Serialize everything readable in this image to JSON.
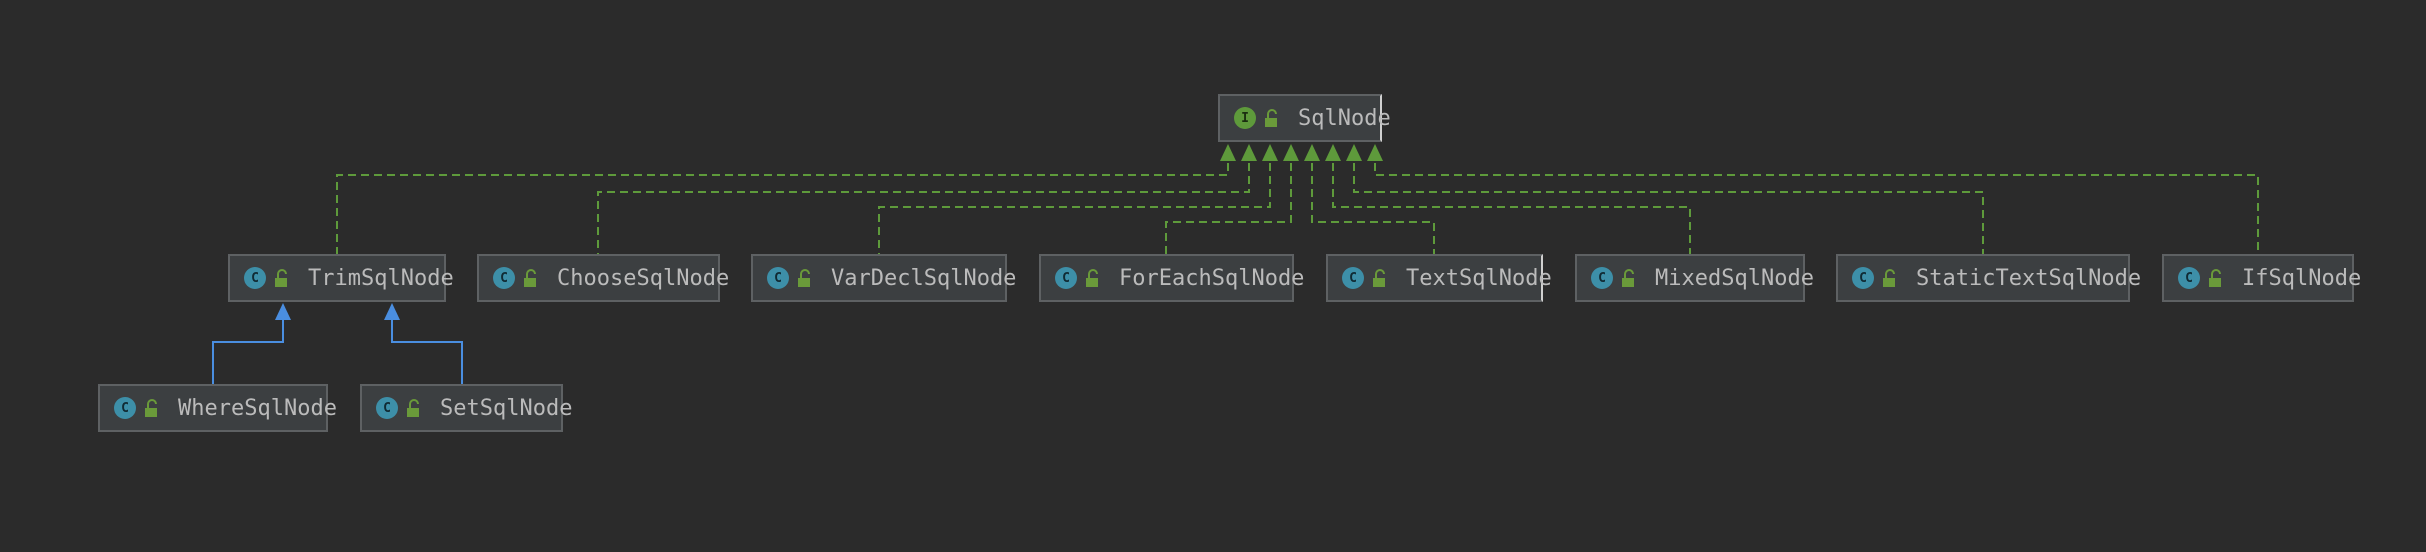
{
  "diagram": {
    "nodes": [
      {
        "id": "SqlNode",
        "name": "SqlNode",
        "kind": "interface",
        "kind_letter": "I"
      },
      {
        "id": "TrimSqlNode",
        "name": "TrimSqlNode",
        "kind": "class",
        "kind_letter": "C"
      },
      {
        "id": "ChooseSqlNode",
        "name": "ChooseSqlNode",
        "kind": "class",
        "kind_letter": "C"
      },
      {
        "id": "VarDeclSqlNode",
        "name": "VarDeclSqlNode",
        "kind": "class",
        "kind_letter": "C"
      },
      {
        "id": "ForEachSqlNode",
        "name": "ForEachSqlNode",
        "kind": "class",
        "kind_letter": "C"
      },
      {
        "id": "TextSqlNode",
        "name": "TextSqlNode",
        "kind": "class",
        "kind_letter": "C"
      },
      {
        "id": "MixedSqlNode",
        "name": "MixedSqlNode",
        "kind": "class",
        "kind_letter": "C"
      },
      {
        "id": "StaticTextSqlNode",
        "name": "StaticTextSqlNode",
        "kind": "class",
        "kind_letter": "C"
      },
      {
        "id": "IfSqlNode",
        "name": "IfSqlNode",
        "kind": "class",
        "kind_letter": "C"
      },
      {
        "id": "WhereSqlNode",
        "name": "WhereSqlNode",
        "kind": "class",
        "kind_letter": "C"
      },
      {
        "id": "SetSqlNode",
        "name": "SetSqlNode",
        "kind": "class",
        "kind_letter": "C"
      }
    ],
    "edges": [
      {
        "from": "TrimSqlNode",
        "to": "SqlNode",
        "relation": "implements"
      },
      {
        "from": "ChooseSqlNode",
        "to": "SqlNode",
        "relation": "implements"
      },
      {
        "from": "VarDeclSqlNode",
        "to": "SqlNode",
        "relation": "implements"
      },
      {
        "from": "ForEachSqlNode",
        "to": "SqlNode",
        "relation": "implements"
      },
      {
        "from": "TextSqlNode",
        "to": "SqlNode",
        "relation": "implements"
      },
      {
        "from": "MixedSqlNode",
        "to": "SqlNode",
        "relation": "implements"
      },
      {
        "from": "StaticTextSqlNode",
        "to": "SqlNode",
        "relation": "implements"
      },
      {
        "from": "IfSqlNode",
        "to": "SqlNode",
        "relation": "implements"
      },
      {
        "from": "WhereSqlNode",
        "to": "TrimSqlNode",
        "relation": "extends"
      },
      {
        "from": "SetSqlNode",
        "to": "TrimSqlNode",
        "relation": "extends"
      }
    ]
  },
  "colors": {
    "background": "#2b2b2b",
    "node_fill": "#3c3f41",
    "node_border": "#5e6163",
    "implements_line": "#5e9a3b",
    "extends_line": "#4a8ee0",
    "class_badge": "#3d8fa8",
    "interface_badge": "#5e9a3b"
  }
}
